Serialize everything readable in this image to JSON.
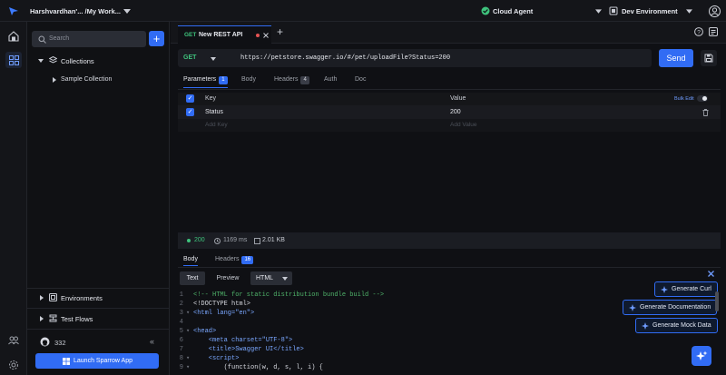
{
  "topbar": {
    "workspace": "Harshvardhan'... /My Work...",
    "agent": "Cloud Agent",
    "environment": "Dev Environment"
  },
  "sidebar": {
    "search_placeholder": "Search",
    "collections_label": "Collections",
    "collection_item": "Sample Collection",
    "environments_label": "Environments",
    "test_flows_label": "Test Flows",
    "github_stars": "332",
    "launch_label": "Launch Sparrow App",
    "collapse_glyph": "«"
  },
  "tab": {
    "method": "GET",
    "name": "New REST API",
    "add_glyph": "+"
  },
  "request": {
    "method": "GET",
    "url": "https://petstore.swagger.io/#/pet/uploadFile?Status=200",
    "send_label": "Send"
  },
  "request_tabs": [
    {
      "label": "Parameters",
      "badge": "1"
    },
    {
      "label": "Body",
      "badge": ""
    },
    {
      "label": "Headers",
      "badge": "4"
    },
    {
      "label": "Auth",
      "badge": ""
    },
    {
      "label": "Doc",
      "badge": ""
    }
  ],
  "params_table": {
    "key_header": "Key",
    "value_header": "Value",
    "bulk_edit": "Bulk Edit",
    "rows": [
      {
        "key": "Status",
        "value": "200"
      }
    ],
    "key_placeholder": "Add Key",
    "value_placeholder": "Add Value"
  },
  "response_status": {
    "code": "200",
    "time": "1169 ms",
    "size": "2.01 KB"
  },
  "response_tabs": [
    {
      "label": "Body",
      "badge": ""
    },
    {
      "label": "Headers",
      "badge": "16"
    }
  ],
  "body_toolbar": {
    "text_label": "Text",
    "preview_label": "Preview",
    "format_label": "HTML"
  },
  "code_lines": [
    {
      "n": "1",
      "fold": "",
      "text": "<!-- HTML for static distribution bundle build -->"
    },
    {
      "n": "2",
      "fold": "",
      "text": "<!DOCTYPE html>"
    },
    {
      "n": "3",
      "fold": "▾",
      "text": "<html lang=\"en\">"
    },
    {
      "n": "4",
      "fold": "",
      "text": ""
    },
    {
      "n": "5",
      "fold": "▾",
      "text": "<head>"
    },
    {
      "n": "6",
      "fold": "",
      "text": "    <meta charset=\"UTF-8\">"
    },
    {
      "n": "7",
      "fold": "",
      "text": "    <title>Swagger UI</title>"
    },
    {
      "n": "8",
      "fold": "▾",
      "text": "    <script>"
    },
    {
      "n": "9",
      "fold": "▾",
      "text": "        (function(w, d, s, l, i) {"
    }
  ],
  "ai_actions": {
    "curl": "Generate Curl",
    "docs": "Generate Documentation",
    "mock": "Generate Mock Data"
  },
  "colors": {
    "accent": "#316cf4",
    "success": "#3ec27c",
    "comment": "#4fb36a",
    "tag": "#7aa7ff"
  }
}
